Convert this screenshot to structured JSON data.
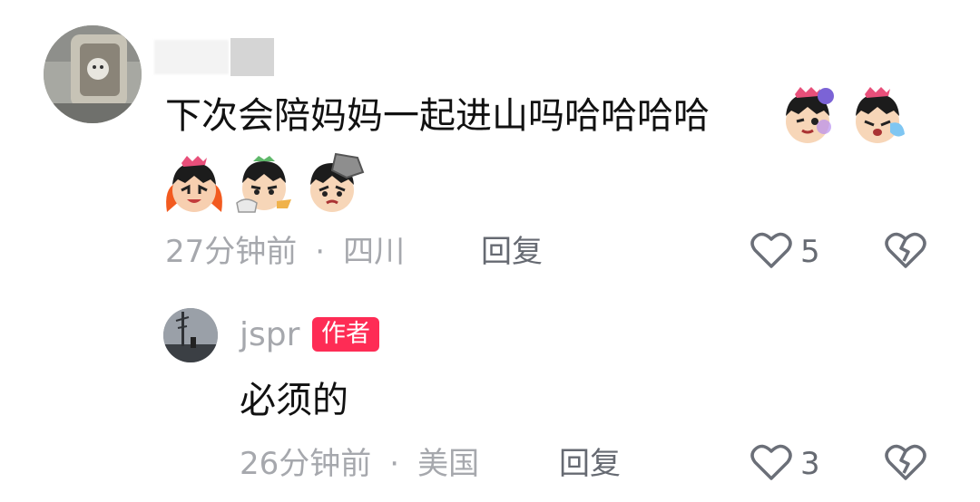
{
  "comment": {
    "text": "下次会陪妈妈一起进山吗哈哈哈哈",
    "time": "27分钟前",
    "location": "四川",
    "reply_label": "回复",
    "like_count": "5",
    "emojis": [
      "mischievous-face-emoji",
      "crying-face-emoji",
      "fiery-laugh-emoji",
      "smirk-thumbs-emoji",
      "rock-on-head-emoji"
    ]
  },
  "reply": {
    "username": "jspr",
    "badge": "作者",
    "text": "必须的",
    "time": "26分钟前",
    "location": "美国",
    "reply_label": "回复",
    "like_count": "3"
  },
  "colors": {
    "badge_bg": "#fe2c55",
    "meta_text": "#a6a8ad",
    "action_text": "#666a72",
    "icon_stroke": "#6b6f78"
  }
}
